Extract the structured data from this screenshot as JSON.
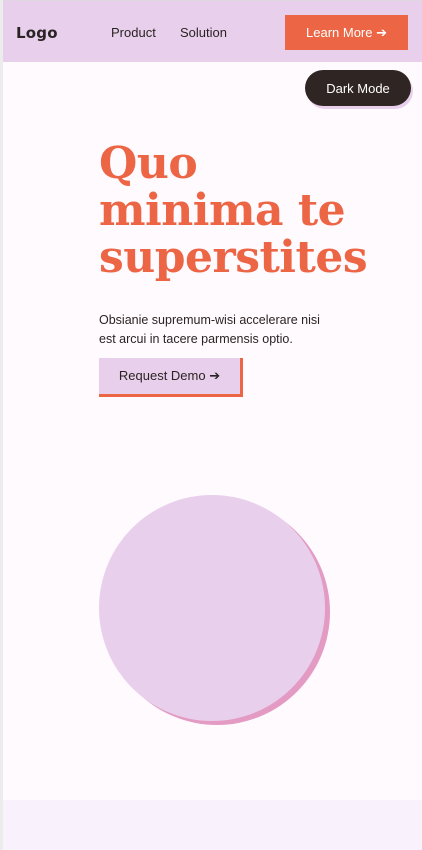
{
  "nav": {
    "logo": "Logo",
    "links": [
      "Product",
      "Solution"
    ],
    "cta_label": "Learn More ➔"
  },
  "theme_toggle_label": "Dark Mode",
  "hero": {
    "title_lines": [
      "Quo",
      "minima te",
      "superstites"
    ],
    "description": "Obsianie supremum-wisi accelerare nisi est arcui in tacere parmensis optio.",
    "cta_label": "Request Demo ➔"
  },
  "colors": {
    "accent": "#ec6545",
    "lavender": "#e8d0ec",
    "pink_shadow": "#e39bc4",
    "dark": "#2f2522",
    "page_bg": "#fffafe"
  }
}
